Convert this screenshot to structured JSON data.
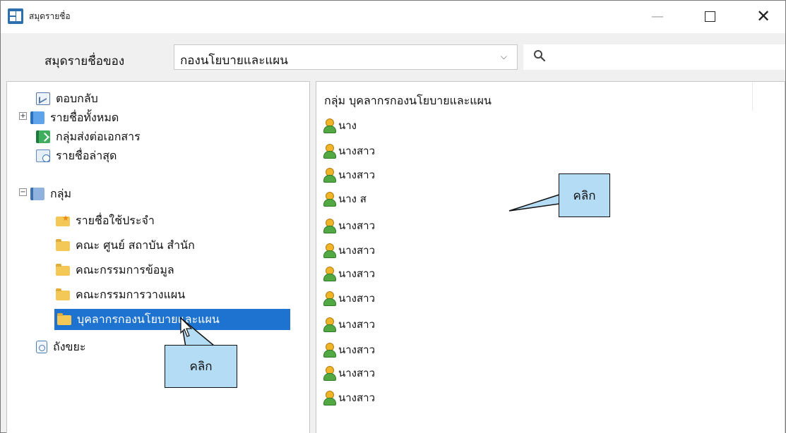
{
  "window": {
    "title": "สมุดรายชื่อ",
    "minimize_label": "—",
    "close_label": "✕"
  },
  "toolbar": {
    "addressbook_label": "สมุดรายชื่อของ",
    "addressbook_value": "กองนโยบายและแผน",
    "dropdown_chevron": "⌵",
    "search_value": ""
  },
  "tree": {
    "expander_plus": "+",
    "expander_minus": "−",
    "items": [
      {
        "label": "ตอบกลับ",
        "icon": "reply-icon"
      },
      {
        "label": "รายชื่อทั้งหมด",
        "icon": "address-book-icon"
      },
      {
        "label": "กลุ่มส่งต่อเอกสาร",
        "icon": "forward-group-icon"
      },
      {
        "label": "รายชื่อล่าสุด",
        "icon": "recent-contacts-icon"
      },
      {
        "label": "กลุ่ม",
        "icon": "groups-book-icon"
      },
      {
        "label": "รายชื่อใช้ประจำ",
        "icon": "favorites-folder-icon"
      },
      {
        "label": "คณะ ศูนย์ สถาบัน สำนัก",
        "icon": "folder-icon"
      },
      {
        "label": "คณะกรรมการข้อมูล",
        "icon": "folder-icon"
      },
      {
        "label": "คณะกรรมการวางแผน",
        "icon": "folder-icon"
      },
      {
        "label": "บุคลากรกองนโยบายและแผน",
        "icon": "folder-icon",
        "selected": true
      },
      {
        "label": "ถังขยะ",
        "icon": "trash-icon"
      }
    ]
  },
  "contacts": {
    "group_heading": "กลุ่ม  บุคลากรกองนโยบายและแผน",
    "items": [
      {
        "name": "นาง"
      },
      {
        "name": "นางสาว"
      },
      {
        "name": "นางสาว"
      },
      {
        "name": "นาง ส"
      },
      {
        "name": "นางสาว"
      },
      {
        "name": "นางสาว"
      },
      {
        "name": "นางสาว"
      },
      {
        "name": "นางสาว"
      },
      {
        "name": "นางสาว"
      },
      {
        "name": "นางสาว"
      },
      {
        "name": "นางสาว"
      },
      {
        "name": "นางสาว"
      }
    ]
  },
  "annotations": {
    "callout_left": "คลิก",
    "callout_right": "คลิก",
    "callout_fill": "#b4dcf4"
  },
  "colors": {
    "selection": "#1e73d0",
    "window_bg": "#f0f0f0"
  }
}
